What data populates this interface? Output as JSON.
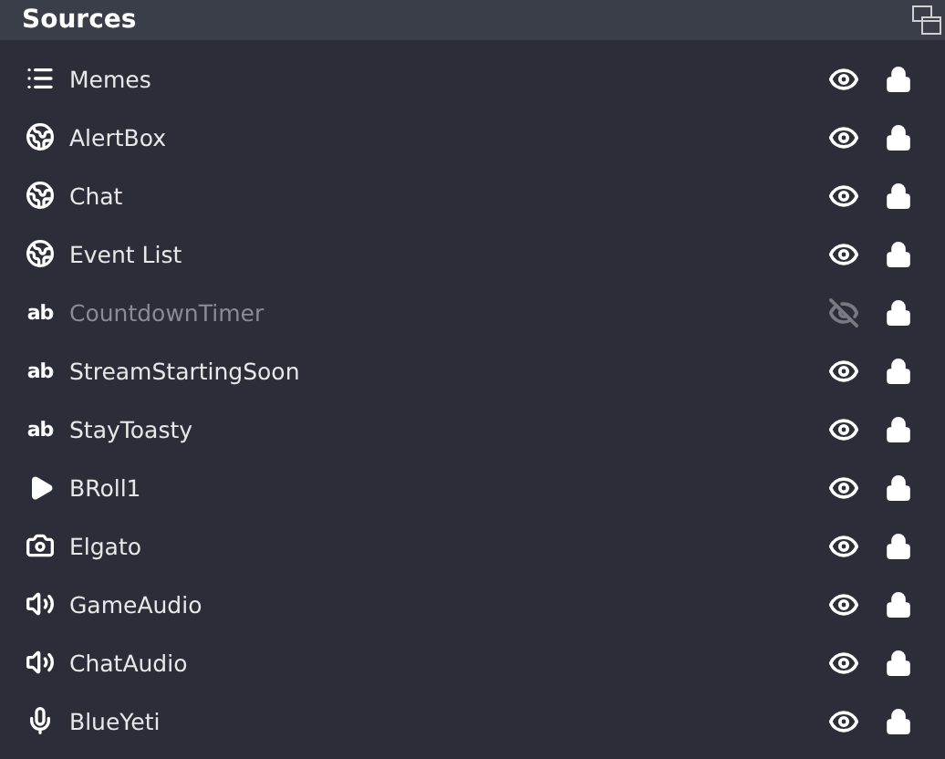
{
  "panel": {
    "title": "Sources"
  },
  "sources": [
    {
      "name": "Memes",
      "kind": "group",
      "visible": true,
      "locked": true
    },
    {
      "name": "AlertBox",
      "kind": "browser",
      "visible": true,
      "locked": true
    },
    {
      "name": "Chat",
      "kind": "browser",
      "visible": true,
      "locked": true
    },
    {
      "name": "Event List",
      "kind": "browser",
      "visible": true,
      "locked": true
    },
    {
      "name": "CountdownTimer",
      "kind": "text",
      "glyph": "ab",
      "visible": false,
      "locked": true
    },
    {
      "name": "StreamStartingSoon",
      "kind": "text",
      "glyph": "ab",
      "visible": true,
      "locked": true
    },
    {
      "name": "StayToasty",
      "kind": "text",
      "glyph": "ab",
      "visible": true,
      "locked": true
    },
    {
      "name": "BRoll1",
      "kind": "media",
      "visible": true,
      "locked": true
    },
    {
      "name": "Elgato",
      "kind": "camera",
      "visible": true,
      "locked": true
    },
    {
      "name": "GameAudio",
      "kind": "audio",
      "visible": true,
      "locked": true
    },
    {
      "name": "ChatAudio",
      "kind": "audio",
      "visible": true,
      "locked": true
    },
    {
      "name": "BlueYeti",
      "kind": "mic",
      "visible": true,
      "locked": true
    }
  ]
}
